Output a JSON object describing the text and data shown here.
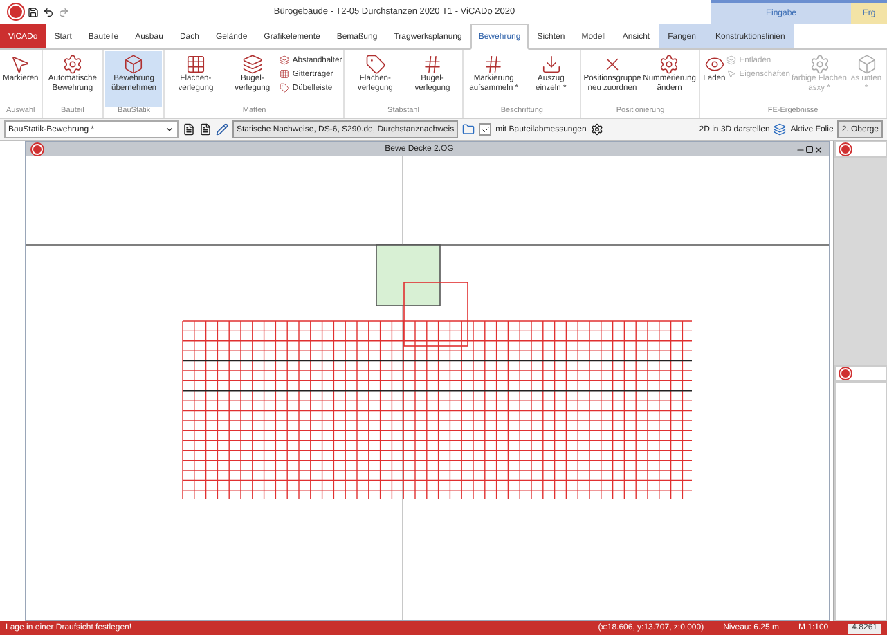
{
  "window": {
    "title": "Bürogebäude - T2-05 Durchstanzen 2020 T1 - ViCADo 2020"
  },
  "context_groups": [
    {
      "label": "Eingabe",
      "color": "#c9d8ef"
    },
    {
      "label": "Erg",
      "color": "#f3e3a6"
    }
  ],
  "tabs": [
    {
      "label": "ViCADo",
      "kind": "app",
      "selected": false
    },
    {
      "label": "Start",
      "kind": "tab",
      "selected": false
    },
    {
      "label": "Bauteile",
      "kind": "tab",
      "selected": false
    },
    {
      "label": "Ausbau",
      "kind": "tab",
      "selected": false
    },
    {
      "label": "Dach",
      "kind": "tab",
      "selected": false
    },
    {
      "label": "Gelände",
      "kind": "tab",
      "selected": false
    },
    {
      "label": "Grafikelemente",
      "kind": "tab",
      "selected": false
    },
    {
      "label": "Bemaßung",
      "kind": "tab",
      "selected": false
    },
    {
      "label": "Tragwerksplanung",
      "kind": "tab",
      "selected": false
    },
    {
      "label": "Bewehrung",
      "kind": "tab",
      "selected": true
    },
    {
      "label": "Sichten",
      "kind": "tab",
      "selected": false
    },
    {
      "label": "Modell",
      "kind": "tab",
      "selected": false
    },
    {
      "label": "Ansicht",
      "kind": "tab",
      "selected": false
    },
    {
      "label": "Fangen",
      "kind": "context",
      "selected": false
    },
    {
      "label": "Konstruktionslinien",
      "kind": "context",
      "selected": false
    }
  ],
  "ribbon_groups": [
    {
      "label": "Auswahl",
      "buttons": [
        {
          "kind": "large",
          "label": "Markieren",
          "selected": false,
          "disabled": false
        }
      ]
    },
    {
      "label": "Bauteil",
      "buttons": [
        {
          "kind": "large",
          "label": "Automatische Bewehrung",
          "selected": false,
          "disabled": false
        }
      ]
    },
    {
      "label": "BauStatik",
      "buttons": [
        {
          "kind": "large",
          "label": "Bewehrung übernehmen",
          "selected": true,
          "disabled": false
        }
      ]
    },
    {
      "label": "Matten",
      "buttons": [
        {
          "kind": "large",
          "label": "Flächen-verlegung",
          "selected": false,
          "disabled": false
        },
        {
          "kind": "large",
          "label": "Bügel-verlegung",
          "selected": false,
          "disabled": false
        },
        {
          "kind": "small",
          "label": "Abstandhalter",
          "selected": false,
          "disabled": false
        },
        {
          "kind": "small",
          "label": "Gitterträger",
          "selected": false,
          "disabled": false
        },
        {
          "kind": "small",
          "label": "Dübelleiste",
          "selected": false,
          "disabled": false
        }
      ]
    },
    {
      "label": "Stabstahl",
      "buttons": [
        {
          "kind": "large",
          "label": "Flächen-verlegung",
          "selected": false,
          "disabled": false
        },
        {
          "kind": "large",
          "label": "Bügel-verlegung",
          "selected": false,
          "disabled": false
        }
      ]
    },
    {
      "label": "Beschriftung",
      "buttons": [
        {
          "kind": "large",
          "label": "Markierung aufsammeln *",
          "selected": false,
          "disabled": false
        },
        {
          "kind": "large",
          "label": "Auszug einzeln *",
          "selected": false,
          "disabled": false
        }
      ]
    },
    {
      "label": "Positionierung",
      "buttons": [
        {
          "kind": "large",
          "label": "Positionsgruppe neu zuordnen",
          "selected": false,
          "disabled": false
        },
        {
          "kind": "large",
          "label": "Nummerierung ändern",
          "selected": false,
          "disabled": false
        }
      ]
    },
    {
      "label": "FE-Ergebnisse",
      "buttons": [
        {
          "kind": "large",
          "label": "Laden",
          "selected": false,
          "disabled": false
        },
        {
          "kind": "small",
          "label": "Entladen",
          "selected": false,
          "disabled": true
        },
        {
          "kind": "small",
          "label": "Eigenschaften",
          "selected": false,
          "disabled": true
        },
        {
          "kind": "large",
          "label": "farbige Flächen asxy *",
          "selected": false,
          "disabled": true
        },
        {
          "kind": "large",
          "label": "as unten *",
          "selected": false,
          "disabled": true
        }
      ]
    }
  ],
  "toolbar": {
    "layer_set": "BauStatik-Bewehrung *",
    "position": "Statische Nachweise, DS-6, S290.de, Durchstanznachweis",
    "dimensions": {
      "label": "mit Bauteilabmessungen",
      "checked": true
    },
    "show_3d": "2D in 3D darstellen",
    "active_layer_label": "Aktive Folie",
    "active_layer": "2. Oberge"
  },
  "drawing_window": {
    "title": "Bewe Decke 2.OG"
  },
  "status_bar": {
    "message": "Lage in einer Draufsicht festlegen!",
    "coordinates": "(x:18.606, y:13.707, z:0.000)",
    "level": "Niveau: 6.25 m",
    "scale": "M 1:100",
    "value": "4.8261"
  }
}
